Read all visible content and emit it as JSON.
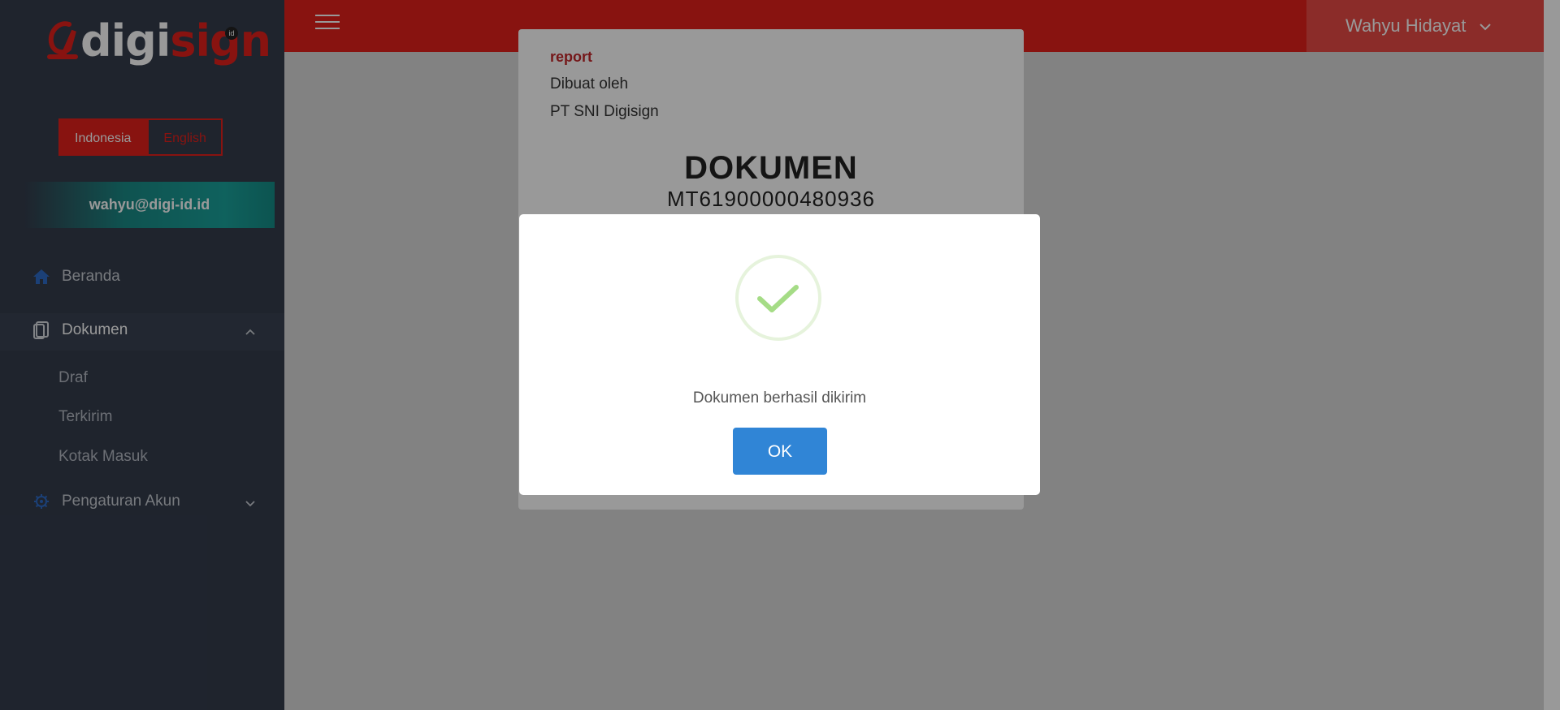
{
  "app": {
    "logo_text_1": "digi",
    "logo_text_2": "sign",
    "logo_badge": "id",
    "brand_color": "#e3201b"
  },
  "sidebar": {
    "languages": [
      {
        "label": "Indonesia",
        "active": true
      },
      {
        "label": "English",
        "active": false
      }
    ],
    "email": "wahyu@digi-id.id",
    "nav": {
      "beranda": {
        "label": "Beranda",
        "icon": "home-icon"
      },
      "dokumen": {
        "label": "Dokumen",
        "icon": "document-icon",
        "expanded": true
      },
      "sub_items": [
        "Draf",
        "Terkirim",
        "Kotak Masuk"
      ],
      "pengaturan": {
        "label": "Pengaturan Akun",
        "icon": "gear-icon",
        "expanded": false
      }
    }
  },
  "header": {
    "menu_icon": "hamburger-icon",
    "user_name": "Wahyu Hidayat"
  },
  "document_card": {
    "label": "report",
    "created_by_label": "Dibuat oleh",
    "company": "PT SNI Digisign",
    "title": "DOKUMEN",
    "number": "MT61900000480936"
  },
  "modal": {
    "icon": "success-check-icon",
    "message": "Dokumen berhasil dikirim",
    "ok_label": "OK",
    "button_color": "#3085d6"
  }
}
